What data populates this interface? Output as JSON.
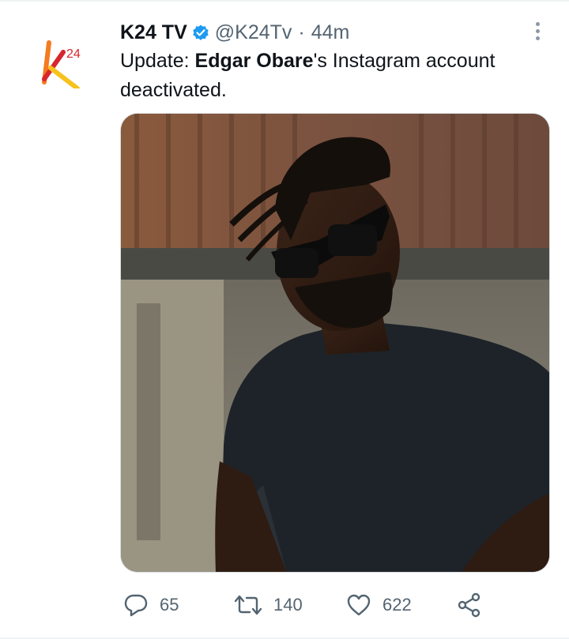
{
  "tweet": {
    "author": {
      "display_name": "K24 TV",
      "handle": "@K24Tv",
      "separator": "·",
      "timestamp": "44m",
      "verified": true,
      "avatar_icon": "k24-logo-icon",
      "avatar_text": "24"
    },
    "text": {
      "prefix": "Update: ",
      "bold_name": "Edgar Obare",
      "suffix": "'s Instagram account deactivated."
    },
    "media": {
      "type": "photo",
      "icon": "photo-icon"
    },
    "actions": {
      "reply_count": "65",
      "retweet_count": "140",
      "like_count": "622"
    }
  },
  "colors": {
    "primary_text": "#0f1419",
    "secondary_text": "#536471",
    "verified_blue": "#1d9bf0",
    "logo_orange": "#f47b20",
    "logo_red": "#d7262e",
    "logo_yellow": "#f6c21c"
  }
}
